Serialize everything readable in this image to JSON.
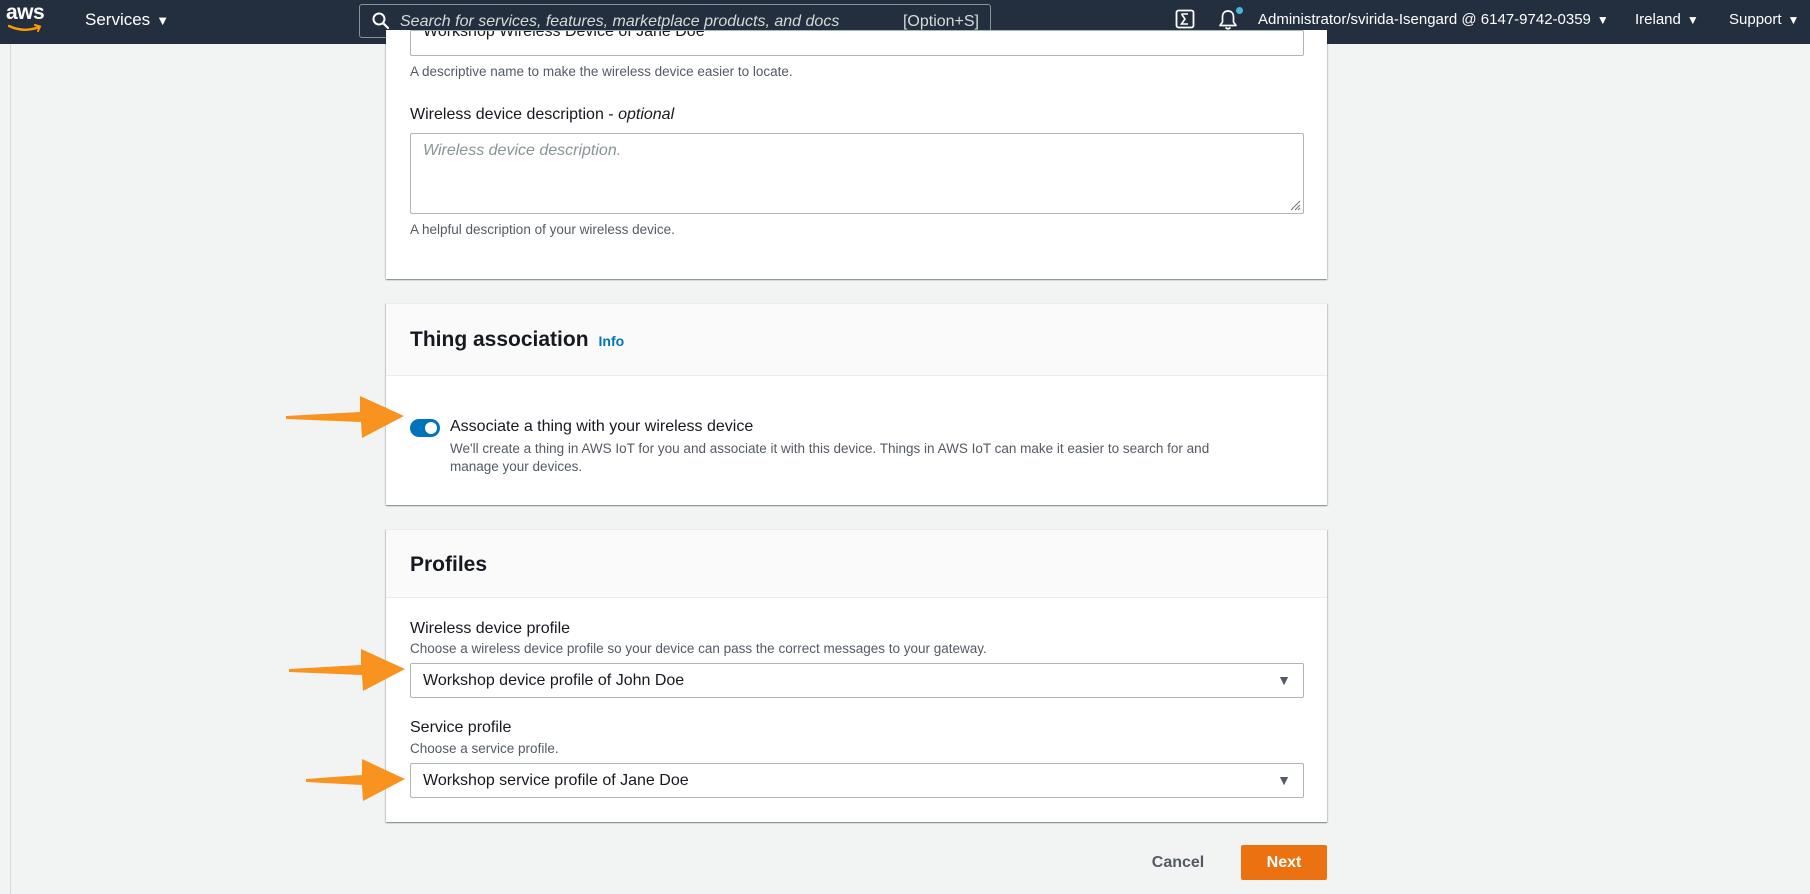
{
  "topnav": {
    "logo_text": "aws",
    "services_label": "Services",
    "search_placeholder": "Search for services, features, marketplace products, and docs",
    "search_shortcut": "[Option+S]",
    "account": "Administrator/svirida-Isengard @ 6147-9742-0359",
    "region": "Ireland",
    "support": "Support"
  },
  "details": {
    "name_value": "Workshop Wireless Device of Jane Doe",
    "name_hint": "A descriptive name to make the wireless device easier to locate.",
    "desc_label": "Wireless device description",
    "desc_optional": "optional",
    "desc_placeholder": "Wireless device description.",
    "desc_hint": "A helpful description of your wireless device."
  },
  "thing": {
    "title": "Thing association",
    "info": "Info",
    "toggle_on": true,
    "toggle_label": "Associate a thing with your wireless device",
    "toggle_desc_1": "We'll create a thing in AWS IoT for you and associate it with this device. Things in AWS IoT can make it easier to search for and",
    "toggle_desc_2": "manage your devices."
  },
  "profiles": {
    "title": "Profiles",
    "device_profile_label": "Wireless device profile",
    "device_profile_hint": "Choose a wireless device profile so your device can pass the correct messages to your gateway.",
    "device_profile_value": "Workshop device profile of John Doe",
    "service_profile_label": "Service profile",
    "service_profile_hint": "Choose a service profile.",
    "service_profile_value": "Workshop service profile of Jane Doe"
  },
  "actions": {
    "cancel": "Cancel",
    "next": "Next"
  },
  "colors": {
    "nav_bg": "#232f3e",
    "primary_button": "#ec7211",
    "toggle_on": "#0073bb",
    "annotation_arrow": "#f7931e"
  }
}
